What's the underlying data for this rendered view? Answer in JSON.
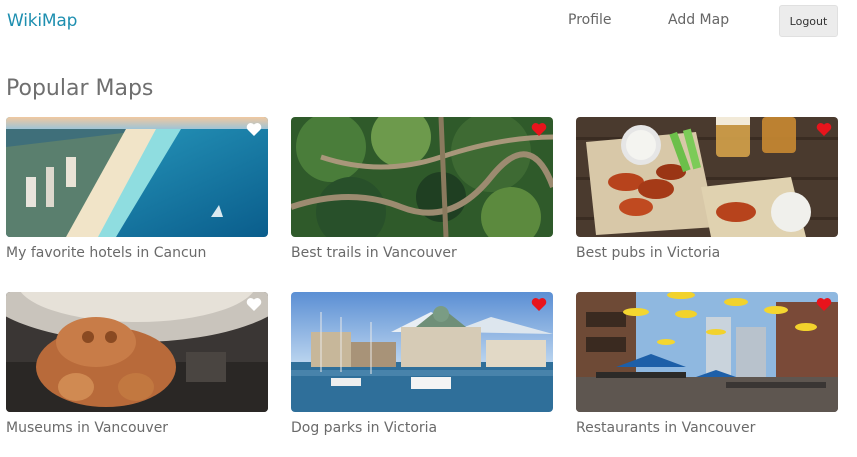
{
  "nav": {
    "brand": "WikiMap",
    "profile": "Profile",
    "add_map": "Add Map",
    "logout": "Logout"
  },
  "section_title": "Popular Maps",
  "colors": {
    "brand": "#1e8fb0",
    "heart_liked": "#e8141c",
    "heart_unliked": "#ffffff"
  },
  "maps": [
    {
      "title": "My favorite hotels in Cancun",
      "liked": false,
      "icon": "heart-icon"
    },
    {
      "title": "Best trails in Vancouver",
      "liked": true,
      "icon": "heart-icon"
    },
    {
      "title": "Best pubs in Victoria",
      "liked": true,
      "icon": "heart-icon"
    },
    {
      "title": "Museums in Vancouver",
      "liked": false,
      "icon": "heart-icon"
    },
    {
      "title": "Dog parks in Victoria",
      "liked": true,
      "icon": "heart-icon"
    },
    {
      "title": "Restaurants in Vancouver",
      "liked": true,
      "icon": "heart-icon"
    }
  ]
}
